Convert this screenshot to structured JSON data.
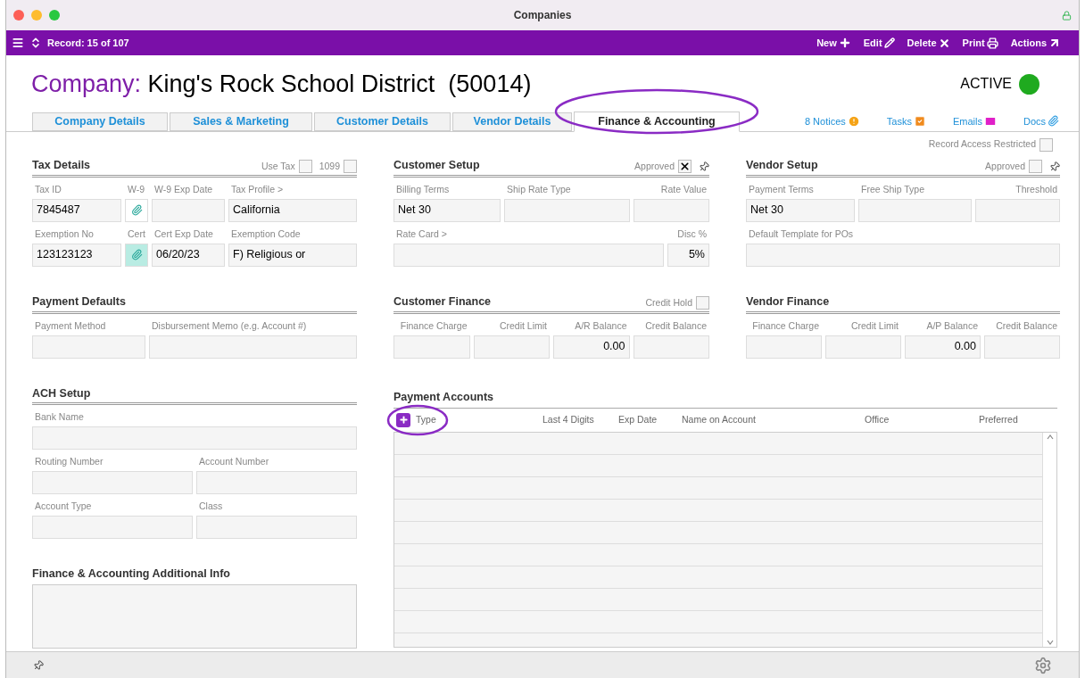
{
  "window": {
    "title": "Companies"
  },
  "toolbar": {
    "record": "Record: 15 of 107",
    "actions": [
      {
        "label": "New",
        "kind": "new"
      },
      {
        "label": "Edit",
        "kind": "edit"
      },
      {
        "label": "Delete",
        "kind": "delete"
      },
      {
        "label": "Print",
        "kind": "print"
      },
      {
        "label": "Actions",
        "kind": "actions"
      }
    ]
  },
  "header": {
    "prefix": "Company:",
    "name": "King's Rock School District  (50014)",
    "status": "ACTIVE",
    "active": true
  },
  "tabs": [
    {
      "label": "Company Details",
      "selected": false,
      "circled": false
    },
    {
      "label": "Sales & Marketing",
      "selected": false,
      "circled": false
    },
    {
      "label": "Customer Details",
      "selected": false,
      "circled": false
    },
    {
      "label": "Vendor Details",
      "selected": false,
      "circled": false
    },
    {
      "label": "Finance & Accounting",
      "selected": true,
      "circled": true
    }
  ],
  "links": [
    {
      "label": "8 Notices",
      "kind": "notices"
    },
    {
      "label": "Tasks",
      "kind": "tasks"
    },
    {
      "label": "Emails",
      "kind": "emails"
    },
    {
      "label": "Docs",
      "kind": "docs"
    }
  ],
  "record_access": {
    "label": "Record Access Restricted",
    "checked": false
  },
  "sections": [
    {
      "title": "Tax Details",
      "options": [
        {
          "kind": "checkbox",
          "label": "Use Tax",
          "checked": false
        },
        {
          "kind": "checkbox",
          "label": "1099",
          "checked": false
        }
      ],
      "fields": [
        {
          "label": "Tax ID",
          "value": "7845487",
          "kind": "text"
        },
        {
          "label": "W-9",
          "kind": "attachment",
          "attached": false
        },
        {
          "label": "W-9 Exp Date",
          "kind": "text"
        },
        {
          "label": "Tax Profile >",
          "value": "California",
          "kind": "text"
        },
        {
          "label": "Exemption No",
          "value": "123123123",
          "kind": "text"
        },
        {
          "label": "Cert",
          "kind": "attachment",
          "attached": true
        },
        {
          "label": "Cert Exp Date",
          "value": "06/20/23",
          "kind": "text"
        },
        {
          "label": "Exemption Code",
          "value": "F) Religious or",
          "kind": "text"
        }
      ]
    },
    {
      "title": "Customer Setup",
      "options": [
        {
          "kind": "checkbox",
          "label": "Approved",
          "checked": true
        },
        {
          "kind": "pin"
        }
      ],
      "fields": [
        {
          "label": "Billing Terms",
          "value": "Net 30",
          "kind": "text"
        },
        {
          "label": "Ship Rate Type",
          "kind": "text"
        },
        {
          "label": "Rate Value",
          "kind": "number"
        },
        {
          "label": "Rate Card >",
          "kind": "text"
        },
        {
          "label": "Disc %",
          "value": "5%",
          "kind": "number"
        }
      ]
    },
    {
      "title": "Vendor Setup",
      "options": [
        {
          "kind": "checkbox",
          "label": "Approved",
          "checked": false
        },
        {
          "kind": "pin"
        }
      ],
      "fields": [
        {
          "label": "Payment Terms",
          "value": "Net 30",
          "kind": "text"
        },
        {
          "label": "Free Ship Type",
          "kind": "text"
        },
        {
          "label": "Threshold",
          "kind": "number"
        },
        {
          "label": "Default Template for POs",
          "kind": "text"
        }
      ]
    },
    {
      "title": "Payment Defaults",
      "fields": [
        {
          "label": "Payment Method",
          "kind": "text"
        },
        {
          "label": "Disbursement Memo (e.g. Account #)",
          "kind": "text"
        }
      ]
    },
    {
      "title": "Customer Finance",
      "options": [
        {
          "kind": "checkbox",
          "label": "Credit Hold",
          "checked": false
        }
      ],
      "fields": [
        {
          "label": "Finance Charge",
          "kind": "number"
        },
        {
          "label": "Credit Limit",
          "kind": "number"
        },
        {
          "label": "A/R Balance",
          "value": "0.00",
          "kind": "number"
        },
        {
          "label": "Credit Balance",
          "kind": "number"
        }
      ]
    },
    {
      "title": "Vendor Finance",
      "fields": [
        {
          "label": "Finance Charge",
          "kind": "number"
        },
        {
          "label": "Credit Limit",
          "kind": "number"
        },
        {
          "label": "A/P Balance",
          "value": "0.00",
          "kind": "number"
        },
        {
          "label": "Credit Balance",
          "kind": "number"
        }
      ]
    },
    {
      "title": "ACH Setup",
      "fields": [
        {
          "label": "Bank Name",
          "kind": "text"
        },
        {
          "label": "Routing Number",
          "kind": "text"
        },
        {
          "label": "Account Number",
          "kind": "text"
        },
        {
          "label": "Account Type",
          "kind": "text"
        },
        {
          "label": "Class",
          "kind": "text"
        }
      ]
    }
  ],
  "payment_accounts": {
    "title": "Payment Accounts",
    "add_circled": true,
    "columns": [
      "Type",
      "Last 4 Digits",
      "Exp Date",
      "Name on Account",
      "Office",
      "Preferred"
    ]
  },
  "additional_info": {
    "title": "Finance & Accounting Additional Info"
  }
}
